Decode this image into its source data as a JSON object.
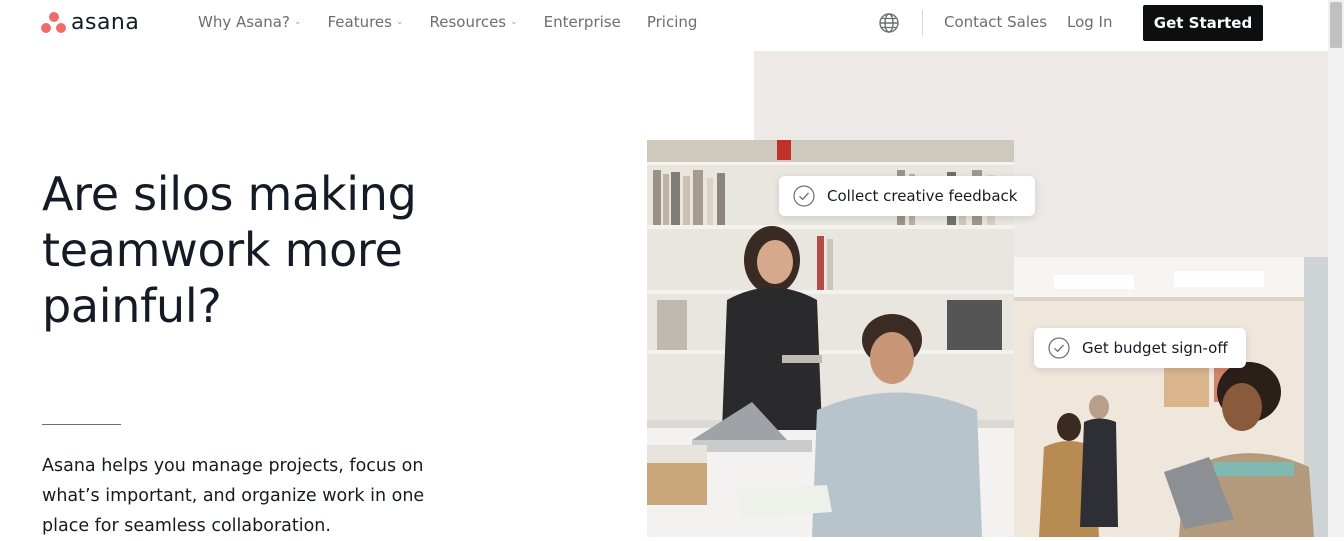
{
  "brand": {
    "name": "asana",
    "color": "#f06a6a"
  },
  "nav": {
    "links": [
      {
        "label": "Why Asana?",
        "dropdown": true
      },
      {
        "label": "Features",
        "dropdown": true
      },
      {
        "label": "Resources",
        "dropdown": true
      },
      {
        "label": "Enterprise",
        "dropdown": false
      },
      {
        "label": "Pricing",
        "dropdown": false
      }
    ],
    "globe_icon": "globe-icon",
    "contact_sales": "Contact Sales",
    "log_in": "Log In",
    "get_started": "Get Started",
    "chevron": "⌄"
  },
  "hero": {
    "title": "Are silos making teamwork more painful?",
    "body": "Asana helps you manage projects, focus on what’s important, and organize work in one place for seamless collaboration."
  },
  "cards": [
    {
      "label": "Collect creative feedback",
      "icon": "check-circle-icon"
    },
    {
      "label": "Get budget sign-off",
      "icon": "check-circle-icon"
    }
  ],
  "colors": {
    "cta_bg": "#0d0e10",
    "beige_panel": "#ece9e6",
    "text": "#151b26",
    "muted": "#6d6e6f"
  }
}
